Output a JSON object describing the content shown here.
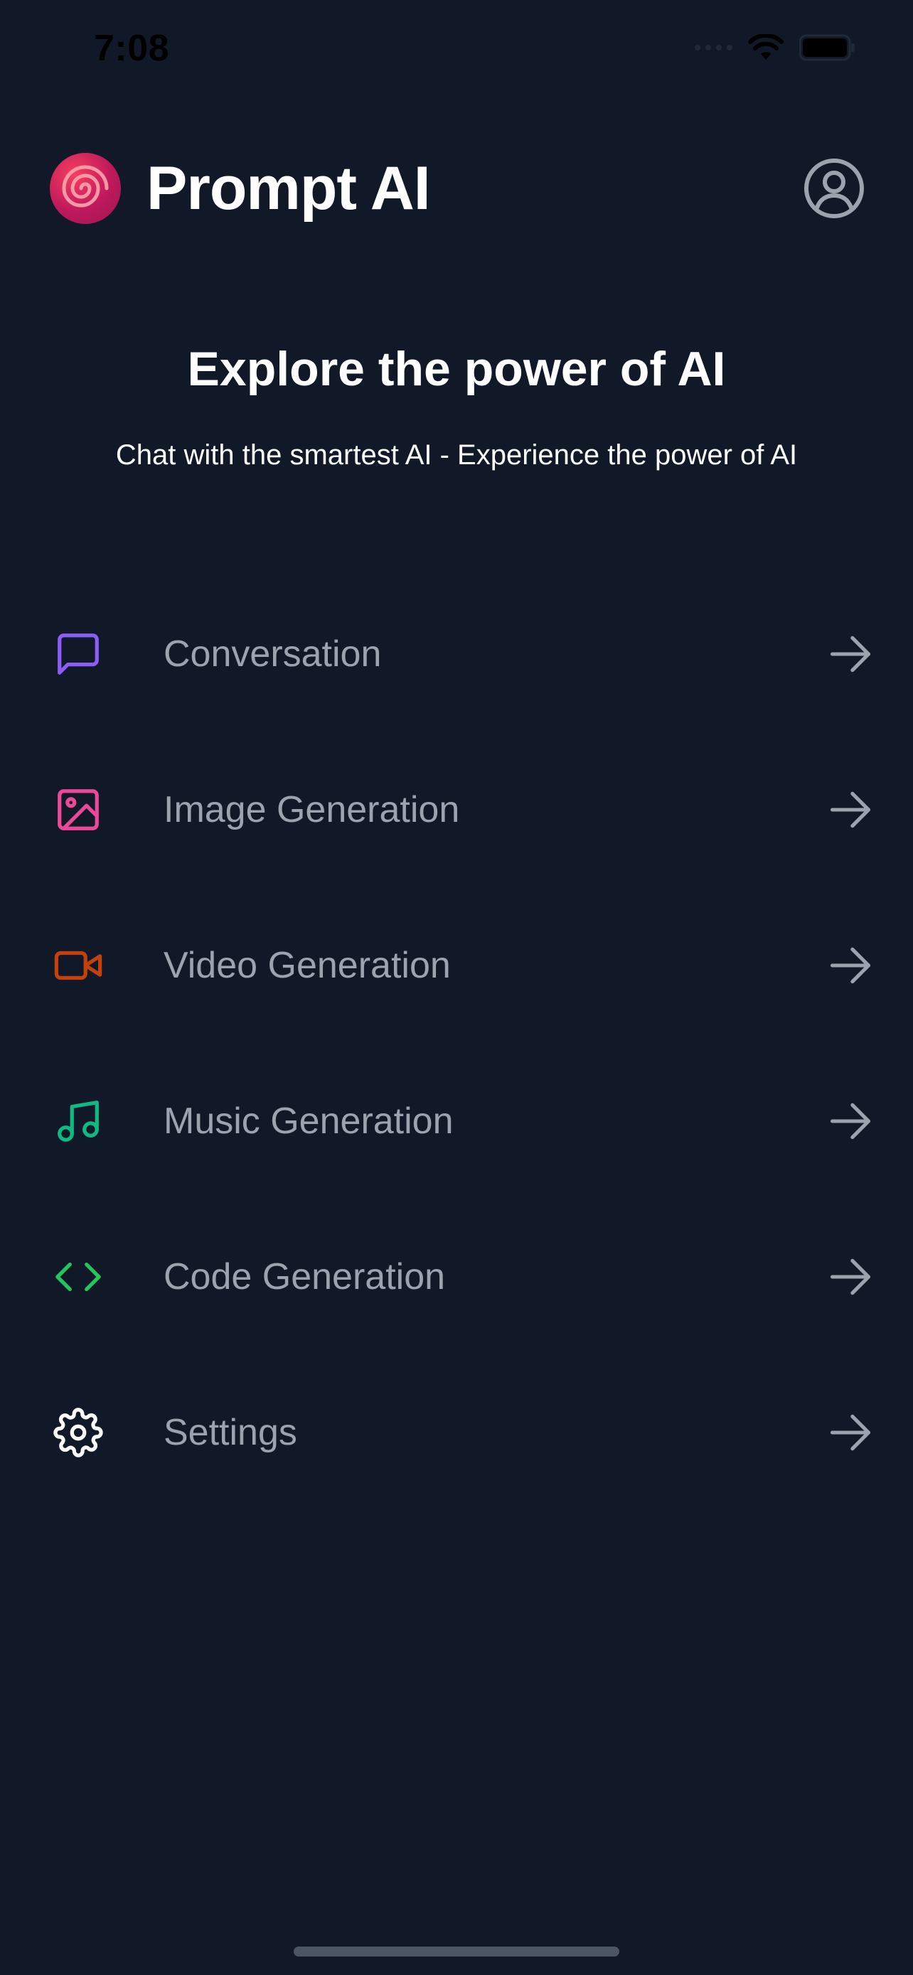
{
  "status_bar": {
    "time": "7:08"
  },
  "header": {
    "title": "Prompt AI",
    "logo_icon": "swirl-logo-icon",
    "profile_icon": "user-circle-icon"
  },
  "hero": {
    "title": "Explore the power of AI",
    "subtitle": "Chat with the smartest AI - Experience the power of AI"
  },
  "menu": {
    "items": [
      {
        "label": "Conversation",
        "icon": "message-square-icon",
        "color": "#8b5cf6"
      },
      {
        "label": "Image Generation",
        "icon": "image-icon",
        "color": "#ec4899"
      },
      {
        "label": "Video Generation",
        "icon": "video-icon",
        "color": "#c2410c"
      },
      {
        "label": "Music Generation",
        "icon": "music-icon",
        "color": "#10b981"
      },
      {
        "label": "Code Generation",
        "icon": "code-icon",
        "color": "#22c55e"
      },
      {
        "label": "Settings",
        "icon": "gear-icon",
        "color": "#ffffff"
      }
    ],
    "arrow_icon": "arrow-right-icon"
  },
  "colors": {
    "background": "#111827",
    "muted_text": "#9ca3af",
    "brand": "#be185d"
  }
}
